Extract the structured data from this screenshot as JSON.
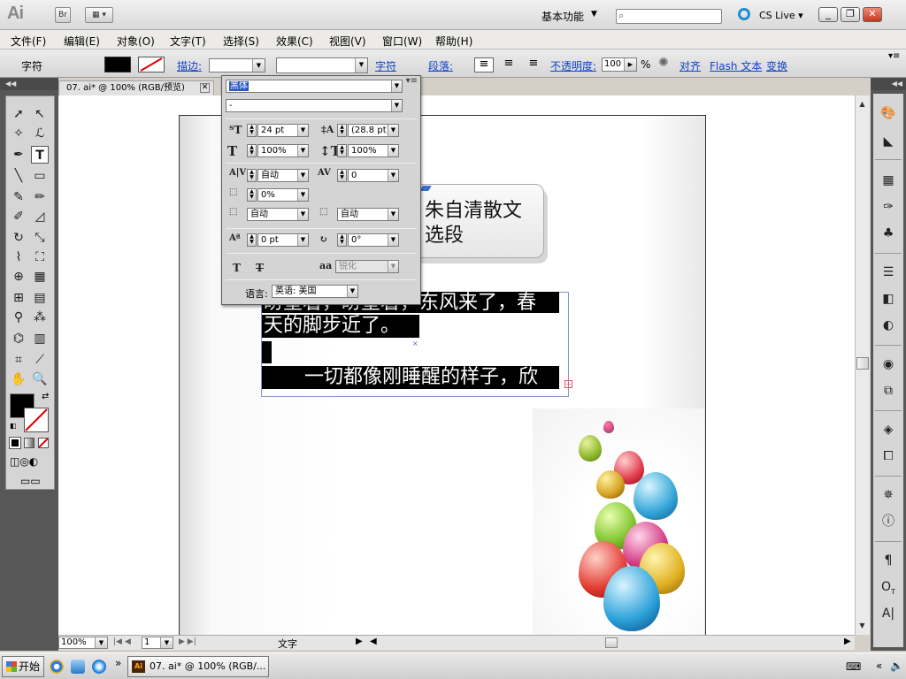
{
  "app": {
    "logo": "Ai",
    "bridge_label": "Br",
    "workspace": "基本功能",
    "cslive": "CS Live",
    "win_minimize": "_",
    "win_restore": "❐",
    "win_close": "✕"
  },
  "menu": {
    "items": [
      "文件(F)",
      "编辑(E)",
      "对象(O)",
      "文字(T)",
      "选择(S)",
      "效果(C)",
      "视图(V)",
      "窗口(W)",
      "帮助(H)"
    ]
  },
  "controlbar": {
    "label": "字符",
    "stroke_label": "描边:",
    "char_link": "字符",
    "para_link": "段落:",
    "opacity_label": "不透明度:",
    "opacity_value": "100",
    "opacity_unit": "%",
    "align_link": "对齐",
    "flash_link": "Flash 文本",
    "transform_link": "变换"
  },
  "document": {
    "tab_title": "07. ai* @ 100% (RGB/预览)",
    "callout_text": "朱自清散文选段",
    "lines": [
      "盼望着，盼望着，东风来了，春",
      "天的脚步近了。",
      "",
      "一切都像刚睡醒的样子，欣"
    ]
  },
  "character_panel": {
    "font_family": "黑体",
    "font_style": "-",
    "font_size": "24 pt",
    "leading": "(28.8 pt)",
    "h_scale": "100%",
    "v_scale": "100%",
    "kerning": "自动",
    "tracking": "0",
    "tsume": "0%",
    "aki_left": "自动",
    "aki_right": "自动",
    "baseline_shift": "0 pt",
    "rotation": "0°",
    "antialias": "锐化",
    "language_label": "语言:",
    "language": "英语: 美国"
  },
  "statusbar": {
    "zoom": "100%",
    "page": "1",
    "tool": "文字"
  },
  "taskbar": {
    "start": "开始",
    "task_title": "07. ai* @ 100% (RGB/...",
    "task_icon": "Ai",
    "overflow": "»"
  },
  "colors": {
    "selection_blue": "#2b56c6",
    "link_blue": "#1244c8",
    "highlight_black": "#000000"
  }
}
